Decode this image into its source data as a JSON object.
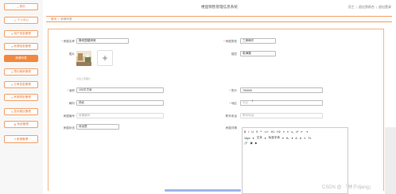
{
  "sidebar": {
    "items": [
      {
        "label": "首页",
        "icon": "home-icon"
      },
      {
        "label": "个人中心",
        "icon": "user-icon"
      },
      {
        "label": "用户信息管理",
        "icon": "list-icon"
      },
      {
        "label": "房源信息管理",
        "icon": "list-icon"
      },
      {
        "label": "房源列表",
        "icon": "list-icon",
        "active": true
      },
      {
        "label": "预约看房管理",
        "icon": "list-icon"
      },
      {
        "label": "订单信息管理",
        "icon": "list-icon"
      },
      {
        "label": "房源类型管理",
        "icon": "list-icon"
      },
      {
        "label": "投诉建议管理",
        "icon": "list-icon"
      },
      {
        "label": "系统管理",
        "icon": "gear-icon"
      },
      {
        "label": "房源管理",
        "icon": "list-icon"
      }
    ]
  },
  "header": {
    "title": "楼盘销售管理信息系统",
    "user": "员工",
    "back_link": "退出到前台",
    "logout_link": "退出登录"
  },
  "breadcrumb": {
    "home": "首页",
    "current": "房源列表"
  },
  "form": {
    "name_label": "房屋名称",
    "name_value": "静安园楼房房",
    "type_label": "房屋类型",
    "type_value": "三房两厅",
    "image_label": "图片",
    "upload_hint": "点击上传图片",
    "location_label": "楼层",
    "location_value": "临海路",
    "area_label": "面积",
    "area_value": "100平方米",
    "price_label": "售价",
    "price_value": "750000",
    "orientation_label": "朝向",
    "orientation_value": "西北",
    "region_label": "地区",
    "region_value": "地区",
    "number_label": "房屋编号",
    "number_value": "房屋编号",
    "contact_label": "联系电话",
    "contact_value": "联系电话",
    "status_label": "房屋状态",
    "status_value": "待出售",
    "detail_label": "房屋详情"
  },
  "editor": {
    "toolbar_row1": [
      "B",
      "I",
      "U",
      "S",
      "❝",
      "</>",
      "H1",
      "H2",
      "≡",
      "≡",
      "x₂",
      "x²",
      "⇤",
      "⇥"
    ],
    "toolbar_row2": [
      "16px",
      "▾",
      "文本",
      "▾",
      "标准字体",
      "▾",
      "Hₓ",
      "▾",
      "A",
      "A",
      "≡",
      "Tx"
    ],
    "toolbar_row3": [
      "🔗",
      "▣",
      "▶"
    ]
  },
  "watermark": "CSDN @ 「林夕djang」"
}
